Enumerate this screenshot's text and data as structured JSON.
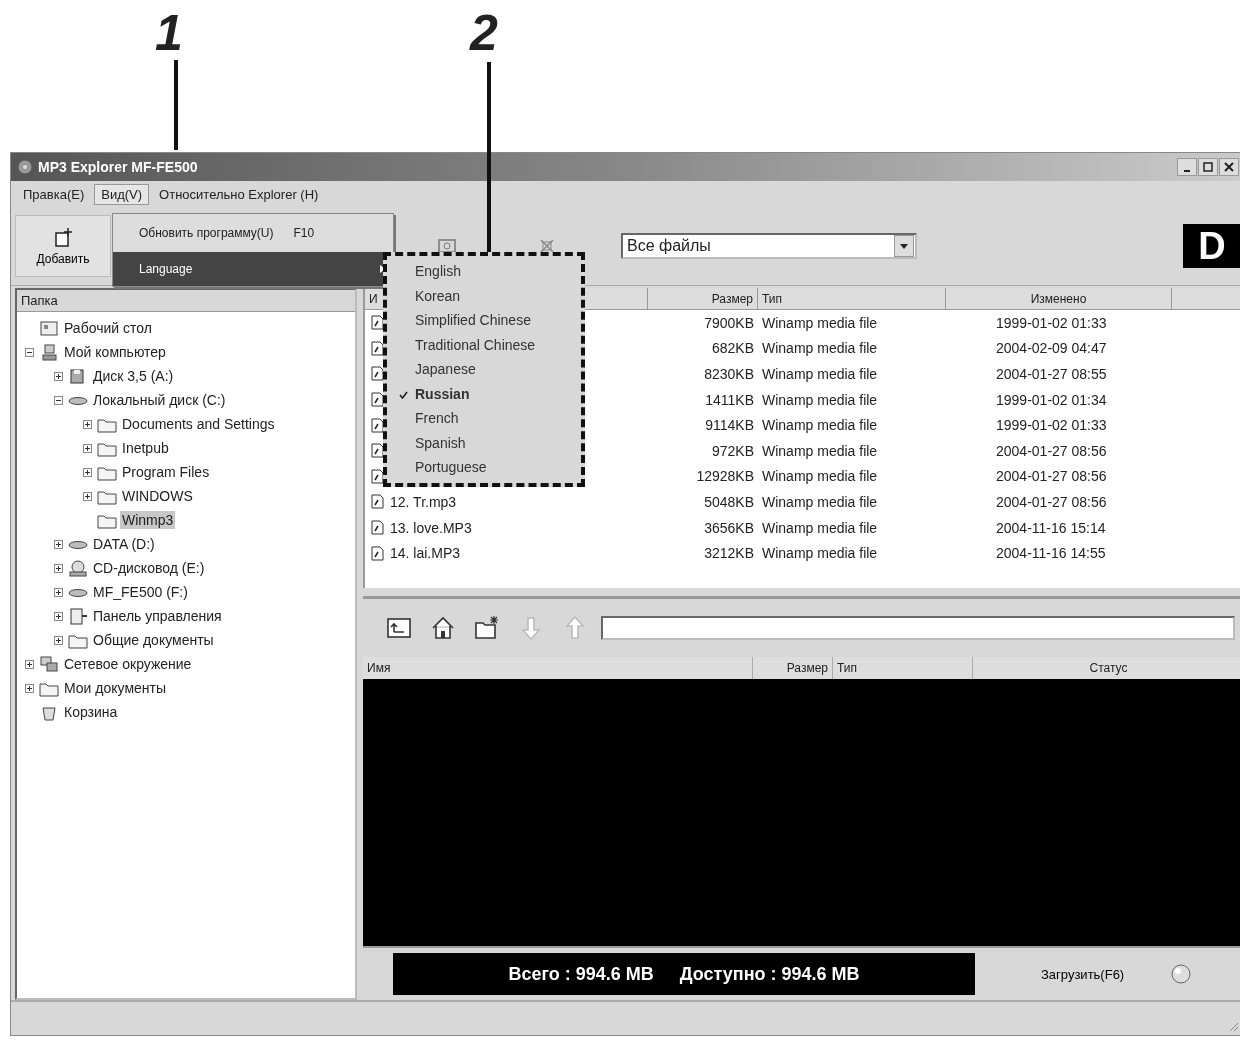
{
  "callouts": [
    {
      "label": "1"
    },
    {
      "label": "2"
    }
  ],
  "window": {
    "title": "MP3 Explorer MF-FE500"
  },
  "menu_bar": [
    {
      "label": "Правка(E)",
      "selected": false
    },
    {
      "label": "Вид(V)",
      "selected": true
    },
    {
      "label": "Относительно Explorer (H)",
      "selected": false
    }
  ],
  "view_menu": [
    {
      "label": "Обновить программу(U)",
      "shortcut": "F10",
      "has_submenu": false,
      "selected": false
    },
    {
      "label": "Language",
      "has_submenu": true,
      "selected": true
    }
  ],
  "language_menu": [
    {
      "label": "English",
      "checked": false
    },
    {
      "label": "Korean",
      "checked": false
    },
    {
      "label": "Simplified Chinese",
      "checked": false
    },
    {
      "label": "Traditional Chinese",
      "checked": false
    },
    {
      "label": "Japanese",
      "checked": false
    },
    {
      "label": "Russian",
      "checked": true
    },
    {
      "label": "French",
      "checked": false
    },
    {
      "label": "Spanish",
      "checked": false
    },
    {
      "label": "Portuguese",
      "checked": false
    }
  ],
  "toolbar": {
    "buttons": [
      {
        "kind": "add",
        "label": "Добавить"
      },
      {
        "kind": "preview"
      },
      {
        "kind": "delete"
      }
    ],
    "filter": {
      "value": "Все файлы"
    },
    "logo": "D"
  },
  "folder_tree": {
    "header": "Папка",
    "items": [
      {
        "label": "Рабочий стол",
        "kind": "desktop",
        "expandable": false,
        "selected": false
      },
      {
        "label": "Мой компьютер",
        "kind": "computer",
        "expandable": true,
        "expanded": true,
        "selected": false,
        "children": [
          {
            "label": "Диск 3,5 (A:)",
            "kind": "floppy",
            "expandable": true,
            "expanded": false,
            "selected": false
          },
          {
            "label": "Локальный диск (C:)",
            "kind": "drive",
            "expandable": true,
            "expanded": true,
            "selected": false,
            "children": [
              {
                "label": "Documents and Settings",
                "kind": "folder",
                "expandable": true,
                "expanded": false,
                "selected": false
              },
              {
                "label": "Inetpub",
                "kind": "folder",
                "expandable": true,
                "expanded": false,
                "selected": false
              },
              {
                "label": "Program Files",
                "kind": "folder",
                "expandable": true,
                "expanded": false,
                "selected": false
              },
              {
                "label": "WINDOWS",
                "kind": "folder",
                "expandable": true,
                "expanded": false,
                "selected": false
              },
              {
                "label": "Winmp3",
                "kind": "folder",
                "expandable": false,
                "selected": true
              }
            ]
          },
          {
            "label": "DATA (D:)",
            "kind": "drive",
            "expandable": true,
            "expanded": false,
            "selected": false
          },
          {
            "label": "CD-дисковод (E:)",
            "kind": "cdrom",
            "expandable": true,
            "expanded": false,
            "selected": false
          },
          {
            "label": "MF_FE500 (F:)",
            "kind": "drive",
            "expandable": true,
            "expanded": false,
            "selected": false
          },
          {
            "label": "Панель управления",
            "kind": "control",
            "expandable": true,
            "expanded": false,
            "selected": false
          },
          {
            "label": "Общие документы",
            "kind": "folder",
            "expandable": true,
            "expanded": false,
            "selected": false
          }
        ]
      },
      {
        "label": "Сетевое окружение",
        "kind": "network",
        "expandable": true,
        "expanded": false,
        "selected": false
      },
      {
        "label": "Мои документы",
        "kind": "folder",
        "expandable": true,
        "expanded": false,
        "selected": false
      },
      {
        "label": "Корзина",
        "kind": "trash",
        "expandable": false,
        "selected": false
      }
    ]
  },
  "file_list": {
    "columns": [
      "И",
      "Размер",
      "Тип",
      "Изменено"
    ],
    "rows": [
      {
        "size": "7900KB",
        "type": "Winamp media file",
        "modified": "1999-01-02 01:33"
      },
      {
        "size": "682KB",
        "type": "Winamp media file",
        "modified": "2004-02-09 04:47"
      },
      {
        "size": "8230KB",
        "type": "Winamp media file",
        "modified": "2004-01-27 08:55"
      },
      {
        "size": "1411KB",
        "type": "Winamp media file",
        "modified": "1999-01-02 01:34"
      },
      {
        "size": "9114KB",
        "type": "Winamp media file",
        "modified": "1999-01-02 01:33"
      },
      {
        "size": "972KB",
        "type": "Winamp media file",
        "modified": "2004-01-27 08:56"
      },
      {
        "size": "12928KB",
        "type": "Winamp media file",
        "modified": "2004-01-27 08:56"
      },
      {
        "name": "12. Tr.mp3",
        "size": "5048KB",
        "type": "Winamp media file",
        "modified": "2004-01-27 08:56"
      },
      {
        "name": "13. love.MP3",
        "size": "3656KB",
        "type": "Winamp media file",
        "modified": "2004-11-16 15:14"
      },
      {
        "name": "14. lai.MP3",
        "size": "3212KB",
        "type": "Winamp media file",
        "modified": "2004-11-16 14:55"
      }
    ]
  },
  "upload_panel": {
    "tools": [
      {
        "kind": "folder-up",
        "disabled": false
      },
      {
        "kind": "home",
        "disabled": false
      },
      {
        "kind": "new-folder",
        "disabled": false
      },
      {
        "kind": "down",
        "disabled": true
      },
      {
        "kind": "up",
        "disabled": true
      }
    ],
    "columns": [
      "Имя",
      "Размер",
      "Тип",
      "Статус"
    ]
  },
  "status": {
    "total": "Всего : 994.6 MB",
    "available": "Доступно : 994.6 MB",
    "upload_button": "Загрузить(F6)"
  }
}
